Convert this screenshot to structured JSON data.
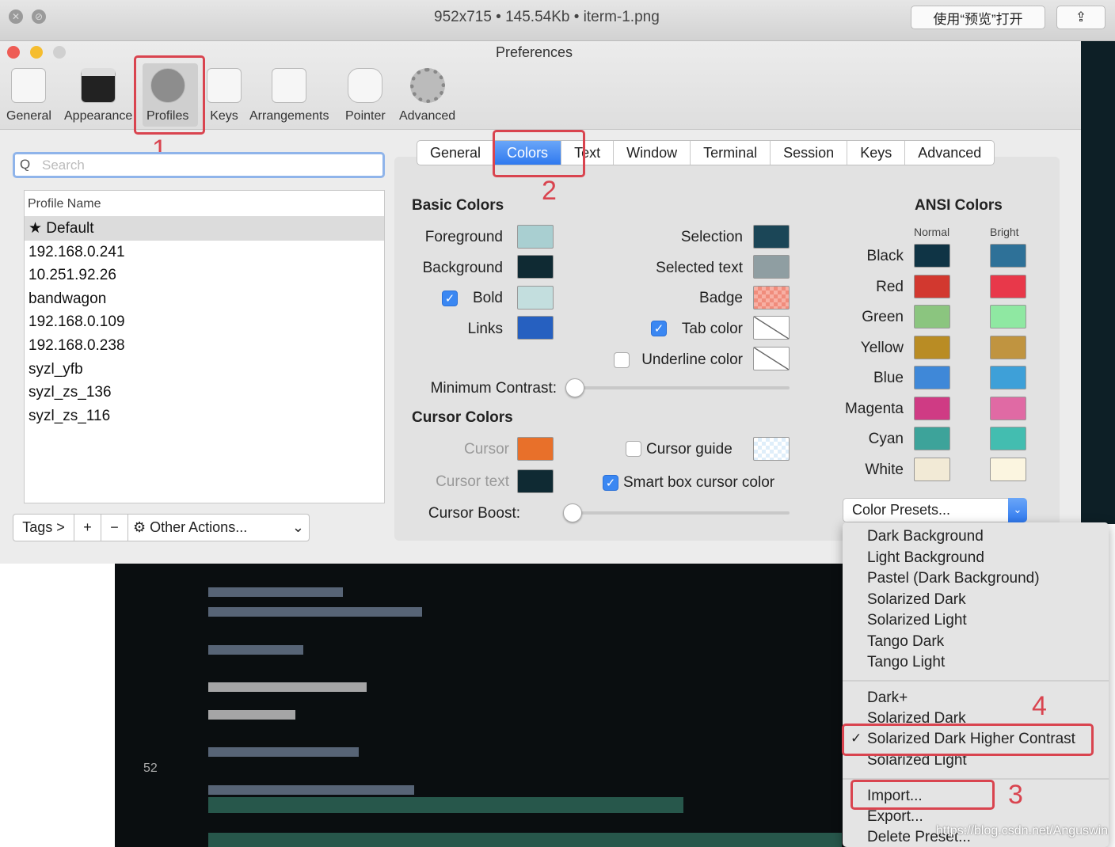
{
  "viewer": {
    "title": "952x715 • 145.54Kb • iterm-1.png",
    "open_button": "使用“预览”打开"
  },
  "window": {
    "title": "Preferences"
  },
  "toolbar": {
    "items": [
      "General",
      "Appearance",
      "Profiles",
      "Keys",
      "Arrangements",
      "Pointer",
      "Advanced"
    ],
    "selected": "Profiles"
  },
  "annotations": {
    "n1": "1",
    "n2": "2",
    "n3": "3",
    "n4": "4"
  },
  "search": {
    "placeholder": "Search"
  },
  "profiles": {
    "header": "Profile Name",
    "items": [
      "★ Default",
      "192.168.0.241",
      "10.251.92.26",
      "bandwagon",
      "192.168.0.109",
      "192.168.0.238",
      "syzl_yfb",
      "syzl_zs_136",
      "syzl_zs_116"
    ],
    "selected": "★ Default"
  },
  "profile_bar": {
    "tags": "Tags >",
    "add": "+",
    "remove": "−",
    "other_actions": "Other Actions..."
  },
  "tabs": {
    "items": [
      "General",
      "Colors",
      "Text",
      "Window",
      "Terminal",
      "Session",
      "Keys",
      "Advanced"
    ],
    "selected": "Colors"
  },
  "basic": {
    "title": "Basic Colors",
    "foreground": "Foreground",
    "background": "Background",
    "bold": "Bold",
    "links": "Links",
    "selection": "Selection",
    "selected_text": "Selected text",
    "badge": "Badge",
    "tab_color": "Tab color",
    "underline_color": "Underline color",
    "min_contrast": "Minimum Contrast:"
  },
  "cursor": {
    "title": "Cursor Colors",
    "cursor": "Cursor",
    "cursor_text": "Cursor text",
    "cursor_guide": "Cursor guide",
    "smart_box": "Smart box cursor color",
    "boost": "Cursor Boost:"
  },
  "colors": {
    "foreground": "#a9cfd1",
    "background": "#0f2a33",
    "bold": "#c3dede",
    "links": "#2660c0",
    "selection": "#1b4657",
    "selected_text": "#8f9ea2",
    "cursor": "#e8702a",
    "cursor_text": "#0f2a33"
  },
  "checks": {
    "bold": true,
    "tab_color": true,
    "underline_color": false,
    "cursor_guide": false,
    "smart_box": true
  },
  "sliders": {
    "min_contrast": 0,
    "cursor_boost": 0
  },
  "ansi": {
    "title": "ANSI Colors",
    "normal": "Normal",
    "bright": "Bright",
    "rows": [
      {
        "name": "Black",
        "normal": "#0f3445",
        "bright": "#2e7198"
      },
      {
        "name": "Red",
        "normal": "#d2382f",
        "bright": "#e8384a"
      },
      {
        "name": "Green",
        "normal": "#8bc57f",
        "bright": "#8fe8a2"
      },
      {
        "name": "Yellow",
        "normal": "#b98c24",
        "bright": "#c09440"
      },
      {
        "name": "Blue",
        "normal": "#3f88d8",
        "bright": "#3ea0d8"
      },
      {
        "name": "Magenta",
        "normal": "#cf3b84",
        "bright": "#e06aa4"
      },
      {
        "name": "Cyan",
        "normal": "#3da39a",
        "bright": "#43bdb0"
      },
      {
        "name": "White",
        "normal": "#f2ead6",
        "bright": "#fbf5e0"
      }
    ]
  },
  "presets": {
    "label": "Color Presets...",
    "group1": [
      "Dark Background",
      "Light Background",
      "Pastel (Dark Background)",
      "Solarized Dark",
      "Solarized Light",
      "Tango Dark",
      "Tango Light"
    ],
    "group2": [
      "Dark+",
      "Solarized Dark",
      "Solarized Dark Higher Contrast",
      "Solarized Light"
    ],
    "checked": "Solarized Dark Higher Contrast",
    "group3": [
      "Import...",
      "Export...",
      "Delete Preset..."
    ]
  },
  "terminal": {
    "line_number": "52"
  },
  "watermark": "https://blog.csdn.net/Anguswin",
  "accent": "#3a87f2",
  "annotation_color": "#d9444f"
}
